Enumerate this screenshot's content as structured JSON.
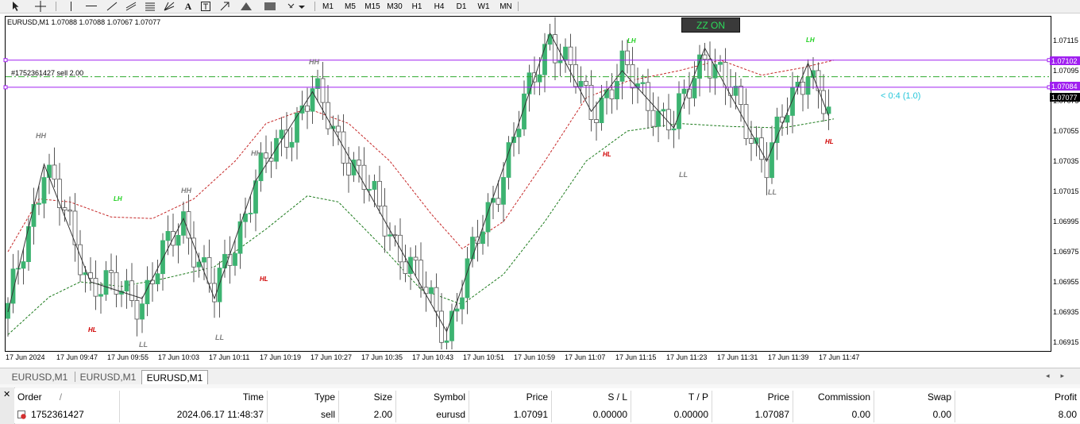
{
  "toolbar": {
    "tools": [
      "cursor-icon",
      "crosshair-icon",
      "vertical-line-icon",
      "horizontal-line-icon",
      "trendline-icon",
      "channel-icon",
      "fibonacci-icon",
      "gann-icon",
      "text-icon",
      "text-label-icon",
      "arrow-icon",
      "triangle-icon",
      "rectangle-icon",
      "arrows-icon"
    ],
    "timeframes": [
      "M1",
      "M5",
      "M15",
      "M30",
      "H1",
      "H4",
      "D1",
      "W1",
      "MN"
    ]
  },
  "chart": {
    "title": "EURUSD,M1  1.07088 1.07088 1.07067 1.07077",
    "zz_button": "ZZ ON",
    "order_line_label": "#1752361427 sell 2.00",
    "ratio_label": "< 0:4 (1.0)",
    "price_labels": [
      "1.07115",
      "1.07095",
      "1.07075",
      "1.07055",
      "1.07035",
      "1.07015",
      "1.06995",
      "1.06975",
      "1.06955",
      "1.06935",
      "1.06915"
    ],
    "price_tags": {
      "upper_line": "1.07102",
      "lower_line": "1.07084",
      "current": "1.07077"
    },
    "time_labels": [
      "17 Jun 2024",
      "17 Jun 09:47",
      "17 Jun 09:55",
      "17 Jun 10:03",
      "17 Jun 10:11",
      "17 Jun 10:19",
      "17 Jun 10:27",
      "17 Jun 10:35",
      "17 Jun 10:43",
      "17 Jun 10:51",
      "17 Jun 10:59",
      "17 Jun 11:07",
      "17 Jun 11:15",
      "17 Jun 11:23",
      "17 Jun 11:31",
      "17 Jun 11:39",
      "17 Jun 11:47"
    ],
    "swing_labels": {
      "hh": "HH",
      "ll": "LL",
      "lh": "LH",
      "hl": "HL"
    },
    "colors": {
      "bull": "#3cb371",
      "bear": "#ffffff",
      "outline": "#555555",
      "zigzag": "#333333",
      "upper_band": "#c62828",
      "lower_band": "#1b7a1b",
      "order_lines": "#a020f0",
      "sl_tp_line": "#2eaa2e",
      "tag_purple": "#a020f0",
      "tag_black": "#000000"
    }
  },
  "chart_data": {
    "type": "candlestick",
    "symbol": "EURUSD",
    "timeframe": "M1",
    "ylim": [
      1.0691,
      1.0712
    ],
    "zigzag": [
      [
        0,
        1.06935
      ],
      [
        7,
        1.07033
      ],
      [
        16,
        1.06955
      ],
      [
        26,
        1.06944
      ],
      [
        34,
        1.06997
      ],
      [
        40,
        1.06944
      ],
      [
        48,
        1.07022
      ],
      [
        59,
        1.07081
      ],
      [
        85,
        1.06922
      ],
      [
        105,
        1.0712
      ],
      [
        113,
        1.07068
      ],
      [
        119,
        1.07095
      ],
      [
        129,
        1.07057
      ],
      [
        135,
        1.0711
      ],
      [
        147,
        1.07035
      ],
      [
        155,
        1.071
      ],
      [
        159,
        1.07065
      ]
    ],
    "upper_band": [
      [
        0,
        1.06975
      ],
      [
        6,
        1.0701
      ],
      [
        12,
        1.07008
      ],
      [
        20,
        1.06998
      ],
      [
        28,
        1.06997
      ],
      [
        36,
        1.0701
      ],
      [
        44,
        1.07035
      ],
      [
        50,
        1.0706
      ],
      [
        58,
        1.0707
      ],
      [
        66,
        1.0706
      ],
      [
        74,
        1.07035
      ],
      [
        82,
        1.07
      ],
      [
        88,
        1.06977
      ],
      [
        96,
        1.06995
      ],
      [
        104,
        1.07035
      ],
      [
        112,
        1.07077
      ],
      [
        120,
        1.07088
      ],
      [
        130,
        1.07095
      ],
      [
        138,
        1.07102
      ],
      [
        146,
        1.07092
      ],
      [
        154,
        1.07097
      ],
      [
        160,
        1.07102
      ]
    ],
    "lower_band": [
      [
        0,
        1.0692
      ],
      [
        8,
        1.06945
      ],
      [
        14,
        1.06955
      ],
      [
        22,
        1.06952
      ],
      [
        30,
        1.06957
      ],
      [
        40,
        1.06965
      ],
      [
        50,
        1.0699
      ],
      [
        58,
        1.07012
      ],
      [
        64,
        1.07008
      ],
      [
        72,
        1.0698
      ],
      [
        80,
        1.0695
      ],
      [
        88,
        1.0694
      ],
      [
        96,
        1.0696
      ],
      [
        104,
        1.06995
      ],
      [
        112,
        1.07035
      ],
      [
        120,
        1.07055
      ],
      [
        130,
        1.0706
      ],
      [
        140,
        1.07058
      ],
      [
        150,
        1.07057
      ],
      [
        160,
        1.07063
      ]
    ],
    "horizontal_lines": [
      1.07102,
      1.07084
    ],
    "sl_tp_line": 1.07091,
    "current_price": 1.07077
  },
  "tabs": [
    "EURUSD,M1",
    "EURUSD,M1",
    "EURUSD,M1"
  ],
  "active_tab": 2,
  "terminal": {
    "columns": [
      "Order",
      "Time",
      "Type",
      "Size",
      "Symbol",
      "Price",
      "S / L",
      "T / P",
      "Price",
      "Commission",
      "Swap",
      "Profit"
    ],
    "sort_indicator": "/",
    "row": [
      "1752361427",
      "2024.06.17 11:48:37",
      "sell",
      "2.00",
      "eurusd",
      "1.07091",
      "0.00000",
      "0.00000",
      "1.07087",
      "0.00",
      "0.00",
      "8.00"
    ]
  }
}
